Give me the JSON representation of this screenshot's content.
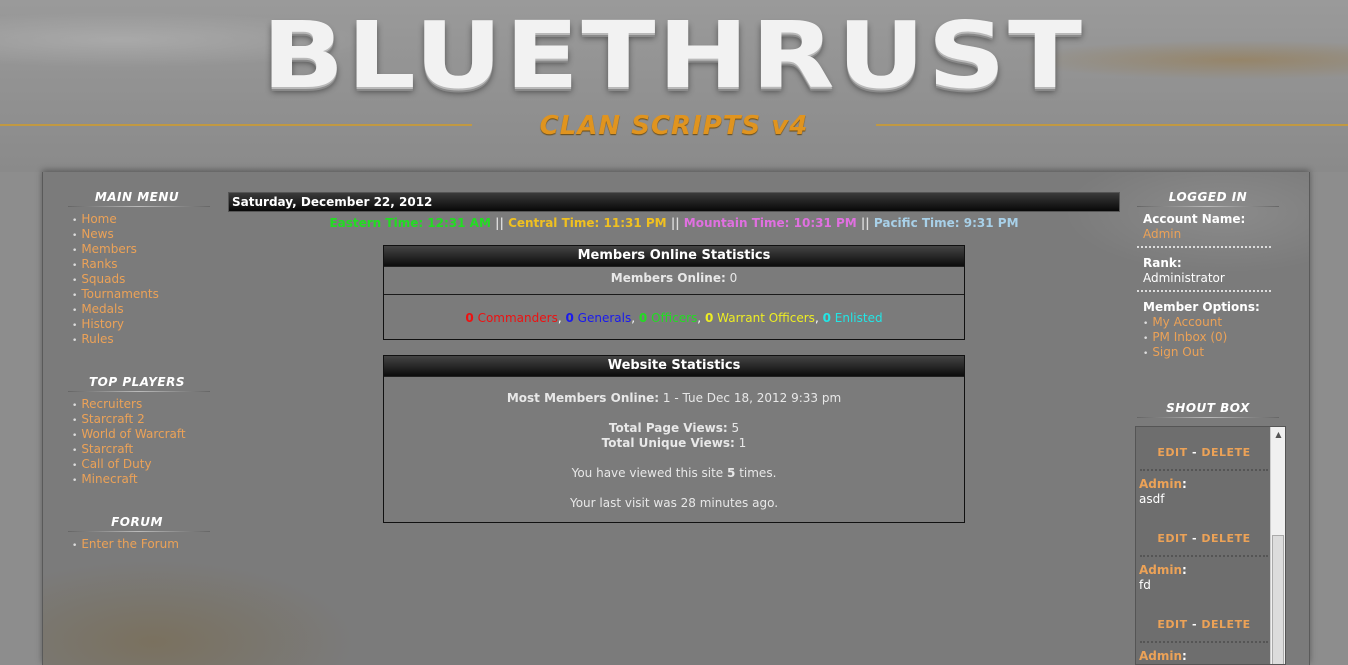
{
  "header": {
    "logo": "BLUETHRUST",
    "subtitle": "CLAN SCRIPTS v4"
  },
  "left_menu": {
    "main_menu": {
      "title": "Main Menu",
      "items": [
        "Home",
        "News",
        "Members",
        "Ranks",
        "Squads",
        "Tournaments",
        "Medals",
        "History",
        "Rules"
      ]
    },
    "top_players": {
      "title": "Top Players",
      "items": [
        "Recruiters",
        "Starcraft 2",
        "World of Warcraft",
        "Starcraft",
        "Call of Duty",
        "Minecraft"
      ]
    },
    "forum": {
      "title": "Forum",
      "items": [
        "Enter the Forum"
      ]
    }
  },
  "center": {
    "date": "Saturday, December 22, 2012",
    "times": {
      "eastern": "Eastern Time: 12:31 AM",
      "central": "Central Time: 11:31 PM",
      "mountain": "Mountain Time: 10:31 PM",
      "pacific": "Pacific Time: 9:31 PM",
      "separator": "||"
    },
    "members_stats": {
      "title": "Members Online Statistics",
      "online_label": "Members Online:",
      "online_value": "0",
      "ranks": [
        {
          "count": "0",
          "label": "Commanders",
          "color": "#ee1111"
        },
        {
          "count": "0",
          "label": "Generals",
          "color": "#1a1aee"
        },
        {
          "count": "0",
          "label": "Officers",
          "color": "#22dd22"
        },
        {
          "count": "0",
          "label": "Warrant Officers",
          "color": "#eeee22"
        },
        {
          "count": "0",
          "label": "Enlisted",
          "color": "#22e6e6"
        }
      ]
    },
    "website_stats": {
      "title": "Website Statistics",
      "most_label": "Most Members Online:",
      "most_value": "1 - Tue Dec 18, 2012 9:33 pm",
      "page_views_label": "Total Page Views:",
      "page_views_value": "5",
      "unique_label": "Total Unique Views:",
      "unique_value": "1",
      "viewed_prefix": "You have viewed this site",
      "viewed_count": "5",
      "viewed_suffix": "times.",
      "last_visit": "Your last visit was 28 minutes ago."
    }
  },
  "right": {
    "logged_in_title": "Logged In",
    "account_name_label": "Account Name:",
    "account_name": "Admin",
    "rank_label": "Rank:",
    "rank": "Administrator",
    "options_label": "Member Options:",
    "options": [
      "My Account",
      "PM Inbox (0)",
      "Sign Out"
    ],
    "shoutbox": {
      "title": "Shout Box",
      "edit": "EDIT",
      "delete": "DELETE",
      "separator": "-",
      "entries": [
        {
          "name": "Admin",
          "message": "asdf"
        },
        {
          "name": "Admin",
          "message": "fd"
        },
        {
          "name": "Admin",
          "message": ""
        }
      ]
    }
  },
  "colors": {
    "link": "#eca257",
    "eastern": "#22dd22",
    "central": "#f0c020",
    "mountain": "#e070e0",
    "pacific": "#a8d0e8"
  }
}
